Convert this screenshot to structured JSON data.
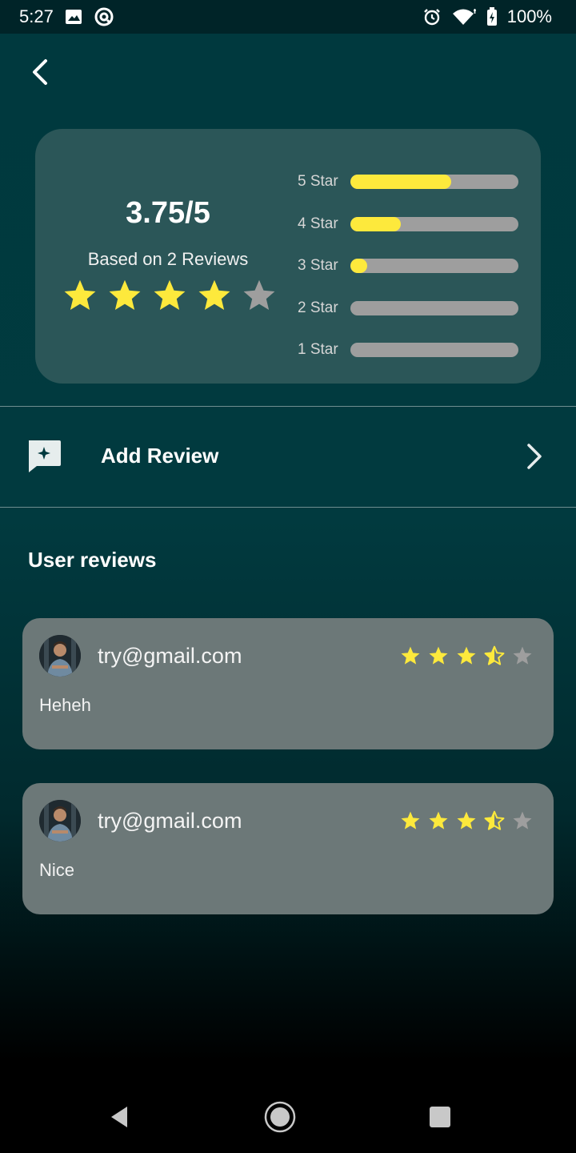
{
  "status_bar": {
    "time": "5:27",
    "battery": "100%",
    "icons_left": [
      "image-icon",
      "sync-icon"
    ],
    "icons_right": [
      "alarm-icon",
      "wifi-icon",
      "battery-icon"
    ]
  },
  "header": {
    "back_icon": "chevron-left-icon"
  },
  "summary": {
    "average": "3.75/5",
    "based_on": "Based on 2 Reviews",
    "star_rating": 3.75,
    "bars": [
      {
        "label": "5 Star",
        "fill": 0.6
      },
      {
        "label": "4 Star",
        "fill": 0.3
      },
      {
        "label": "3 Star",
        "fill": 0.1
      },
      {
        "label": "2 Star",
        "fill": 0.0
      },
      {
        "label": "1 Star",
        "fill": 0.0
      }
    ]
  },
  "add_review": {
    "label": "Add Review",
    "icon": "add-comment-icon",
    "chevron": "chevron-right-icon"
  },
  "reviews_section": {
    "title": "User reviews",
    "reviews": [
      {
        "email": "try@gmail.com",
        "text": "Heheh",
        "rating": 3.5
      },
      {
        "email": "try@gmail.com",
        "text": "Nice",
        "rating": 3.5
      }
    ]
  },
  "colors": {
    "star_filled": "#fde93c",
    "star_empty": "#9e9e9e",
    "card_bg": "#2b5658",
    "review_card_bg": "#6c7878"
  }
}
